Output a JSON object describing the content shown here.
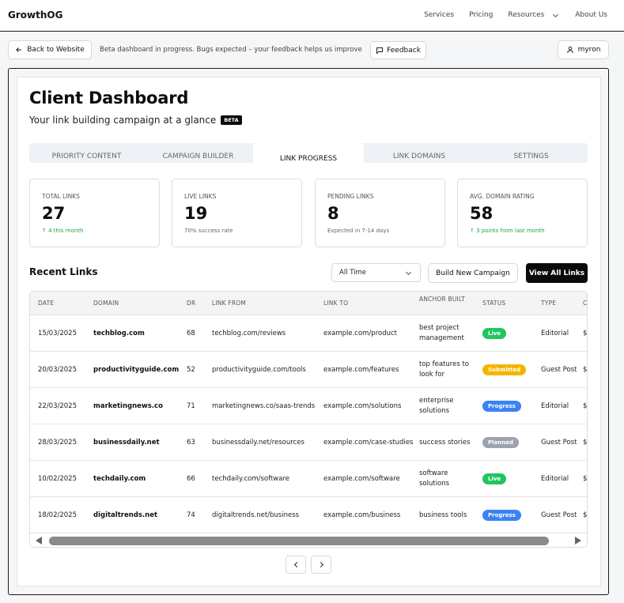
{
  "nav": {
    "brand": "GrowthOG",
    "links": [
      "Services",
      "Pricing",
      "Resources",
      "About Us"
    ]
  },
  "toolbar": {
    "back_label": "Back to Website",
    "beta_note": "Beta dashboard in progress. Bugs expected – your feedback helps us improve",
    "feedback_label": "Feedback",
    "user_label": "myron"
  },
  "header": {
    "title": "Client Dashboard",
    "subtitle": "Your link building campaign at a glance",
    "badge": "BETA"
  },
  "tabs": [
    "PRIORITY CONTENT",
    "CAMPAIGN BUILDER",
    "LINK PROGRESS",
    "LINK DOMAINS",
    "SETTINGS"
  ],
  "active_tab": "LINK PROGRESS",
  "stats": [
    {
      "label": "TOTAL LINKS",
      "value": "27",
      "note": "↑ 4 this month"
    },
    {
      "label": "LIVE LINKS",
      "value": "19",
      "note": "70% success rate"
    },
    {
      "label": "PENDING LINKS",
      "value": "8",
      "note": "Expected in 7-14 days"
    },
    {
      "label": "AVG. DOMAIN RATING",
      "value": "58",
      "note": "↑ 3 points from last month"
    }
  ],
  "recent": {
    "title": "Recent Links",
    "filter": "All Time",
    "build_label": "Build New Campaign",
    "view_label": "View All Links"
  },
  "table": {
    "headers": [
      "DATE",
      "DOMAIN",
      "DR",
      "LINK FROM",
      "LINK TO",
      "ANCHOR BUILT",
      "STATUS",
      "TYPE",
      "C"
    ],
    "rows": [
      {
        "date": "15/03/2025",
        "domain": "techblog.com",
        "dr": "68",
        "from": "techblog.com/reviews",
        "to": "example.com/product",
        "anchor": "best project management",
        "status": "Live",
        "type": "Editorial",
        "extra": "$"
      },
      {
        "date": "20/03/2025",
        "domain": "productivityguide.com",
        "dr": "52",
        "from": "productivityguide.com/tools",
        "to": "example.com/features",
        "anchor": "top features to look for",
        "status": "Submitted",
        "type": "Guest Post",
        "extra": "$"
      },
      {
        "date": "22/03/2025",
        "domain": "marketingnews.co",
        "dr": "71",
        "from": "marketingnews.co/saas-trends",
        "to": "example.com/solutions",
        "anchor": "enterprise solutions",
        "status": "Progress",
        "type": "Editorial",
        "extra": "$"
      },
      {
        "date": "28/03/2025",
        "domain": "businessdaily.net",
        "dr": "63",
        "from": "businessdaily.net/resources",
        "to": "example.com/case-studies",
        "anchor": "success stories",
        "status": "Planned",
        "type": "Guest Post",
        "extra": "$"
      },
      {
        "date": "10/02/2025",
        "domain": "techdaily.com",
        "dr": "66",
        "from": "techdaily.com/software",
        "to": "example.com/software",
        "anchor": "software solutions",
        "status": "Live",
        "type": "Editorial",
        "extra": "$"
      },
      {
        "date": "18/02/2025",
        "domain": "digitaltrends.net",
        "dr": "74",
        "from": "digitaltrends.net/business",
        "to": "example.com/business",
        "anchor": "business tools",
        "status": "Progress",
        "type": "Guest Post",
        "extra": "$"
      }
    ]
  },
  "status_colors": {
    "Live": "#22c55e",
    "Submitted": "#f5b301",
    "Progress": "#3b82f6",
    "Planned": "#9ca3af"
  },
  "colors": {
    "accent": "#0a0a0a",
    "positive": "#1fa34a"
  }
}
